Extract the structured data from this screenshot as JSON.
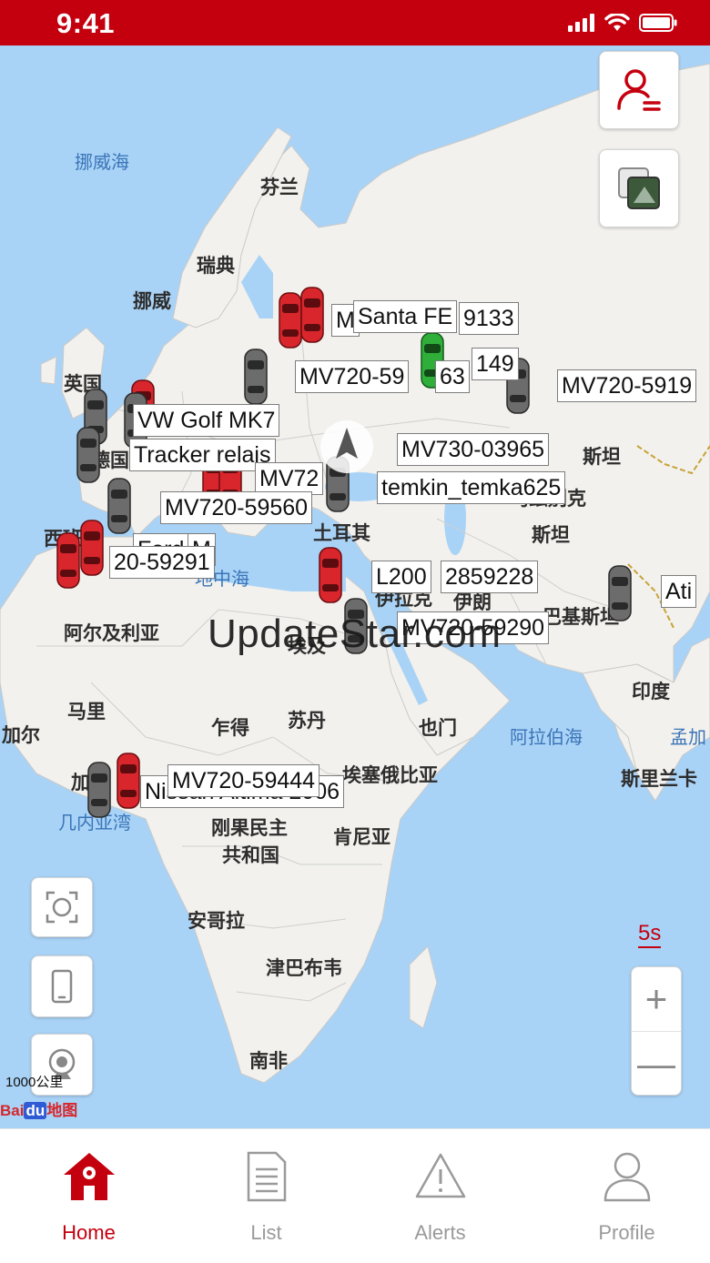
{
  "status": {
    "time": "9:41"
  },
  "map": {
    "places": [
      {
        "id": "finland",
        "text": "芬兰"
      },
      {
        "id": "sweden",
        "text": "瑞典"
      },
      {
        "id": "norway",
        "text": "挪威"
      },
      {
        "id": "uk",
        "text": "英国"
      },
      {
        "id": "germany",
        "text": "德国"
      },
      {
        "id": "spain",
        "text": "西班"
      },
      {
        "id": "turkey",
        "text": "土耳其"
      },
      {
        "id": "kazakhstan",
        "text": "斯坦"
      },
      {
        "id": "uzbekistan",
        "text": "乌兹别克"
      },
      {
        "id": "uzbekistan2",
        "text": "斯坦"
      },
      {
        "id": "algeria",
        "text": "阿尔及利亚"
      },
      {
        "id": "egypt",
        "text": "埃及"
      },
      {
        "id": "mali",
        "text": "马里"
      },
      {
        "id": "chad",
        "text": "乍得"
      },
      {
        "id": "sudan",
        "text": "苏丹"
      },
      {
        "id": "yemen",
        "text": "也门"
      },
      {
        "id": "ethiopia",
        "text": "埃塞俄比亚"
      },
      {
        "id": "india",
        "text": "印度"
      },
      {
        "id": "srilanka",
        "text": "斯里兰卡"
      },
      {
        "id": "senegal",
        "text": "加尔"
      },
      {
        "id": "ghana",
        "text": "加"
      },
      {
        "id": "drc",
        "text": "刚果民主"
      },
      {
        "id": "drc2",
        "text": "共和国"
      },
      {
        "id": "kenya",
        "text": "肯尼亚"
      },
      {
        "id": "angola",
        "text": "安哥拉"
      },
      {
        "id": "zimbabwe",
        "text": "津巴布韦"
      },
      {
        "id": "southafrica",
        "text": "南非"
      },
      {
        "id": "iran",
        "text": "伊朗"
      },
      {
        "id": "iraq",
        "text": "伊拉克"
      },
      {
        "id": "pakistan",
        "text": "巴基斯坦"
      }
    ],
    "seas": [
      {
        "id": "norwegian-sea",
        "text": "挪威海"
      },
      {
        "id": "mediterranean",
        "text": "地中海"
      },
      {
        "id": "arabian-sea",
        "text": "阿拉伯海"
      },
      {
        "id": "bengal",
        "text": "孟加"
      },
      {
        "id": "guinea-gulf",
        "text": "几内亚湾"
      }
    ],
    "vehicle_tags": [
      {
        "id": "t1",
        "text": "M"
      },
      {
        "id": "t2",
        "text": "Santa FE"
      },
      {
        "id": "t3",
        "text": "9133"
      },
      {
        "id": "t4",
        "text": "149"
      },
      {
        "id": "t5",
        "text": "MV720-59"
      },
      {
        "id": "t6",
        "text": "63"
      },
      {
        "id": "t7",
        "text": "MV720-5919"
      },
      {
        "id": "t8",
        "text": "VW Golf MK7"
      },
      {
        "id": "t9",
        "text": "Tracker relais"
      },
      {
        "id": "t10",
        "text": "MV730-03965"
      },
      {
        "id": "t11",
        "text": "MV72"
      },
      {
        "id": "t12",
        "text": "temkin_temka625"
      },
      {
        "id": "t13",
        "text": "MV720-59560"
      },
      {
        "id": "t14",
        "text": "Ford"
      },
      {
        "id": "t15",
        "text": "20-59291"
      },
      {
        "id": "t16",
        "text": "M"
      },
      {
        "id": "t17",
        "text": "L200"
      },
      {
        "id": "t18",
        "text": "2859228"
      },
      {
        "id": "t19",
        "text": "MV720-59290"
      },
      {
        "id": "t20",
        "text": "Ati"
      },
      {
        "id": "t21",
        "text": "Nissan Altima 2006"
      },
      {
        "id": "t22",
        "text": "MV720-59444"
      }
    ],
    "watermark": "UpdateStar.com",
    "refresh_interval": "5s",
    "zoom_in": "+",
    "zoom_out": "—",
    "scale_label": "1000公里",
    "baidu_logo": {
      "bai": "Bai",
      "du": "du",
      "map": "地图"
    }
  },
  "tabs": [
    {
      "label": "Home",
      "icon": "home-icon",
      "active": true
    },
    {
      "label": "List",
      "icon": "list-icon",
      "active": false
    },
    {
      "label": "Alerts",
      "icon": "alert-icon",
      "active": false
    },
    {
      "label": "Profile",
      "icon": "profile-icon",
      "active": false
    }
  ],
  "colors": {
    "brand": "#c4000f",
    "sea": "#a9d3f6",
    "land": "#f2f1ed",
    "car_red": "#d8262c",
    "car_gray": "#6c6c6c",
    "car_green": "#2fae3a"
  }
}
